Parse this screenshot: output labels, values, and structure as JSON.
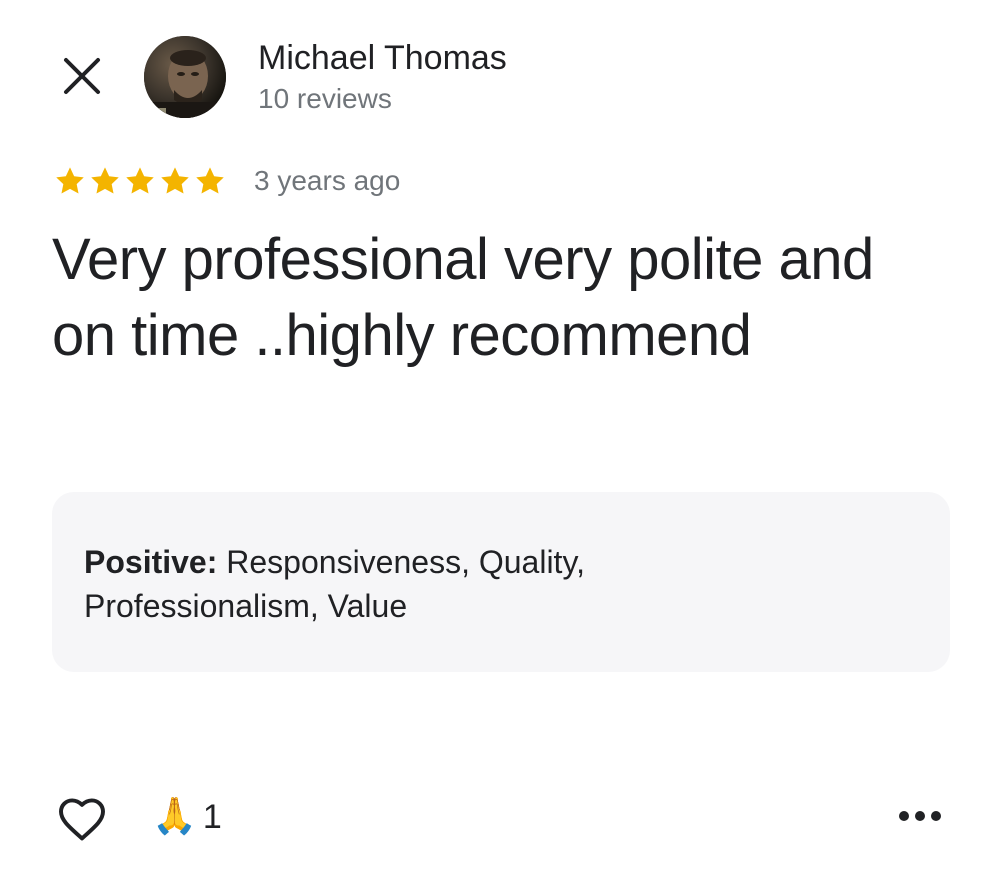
{
  "header": {
    "close_icon": "close-icon",
    "author_name": "Michael Thomas",
    "review_count": "10 reviews"
  },
  "rating": {
    "stars": 5,
    "max_stars": 5,
    "star_color": "#F4B400",
    "time_ago": "3 years ago"
  },
  "review": {
    "text": "Very professional very polite and on time ..highly recommend"
  },
  "attributes": {
    "label": "Positive:",
    "values": "Responsiveness, Quality, Professionalism, Value"
  },
  "actions": {
    "like_icon": "heart-outline-icon",
    "reaction_emoji": "🙏",
    "reaction_count": "1",
    "more_icon": "more-horizontal-icon"
  },
  "colors": {
    "text_primary": "#202124",
    "text_secondary": "#70757A",
    "panel_background": "#F6F6F8"
  }
}
